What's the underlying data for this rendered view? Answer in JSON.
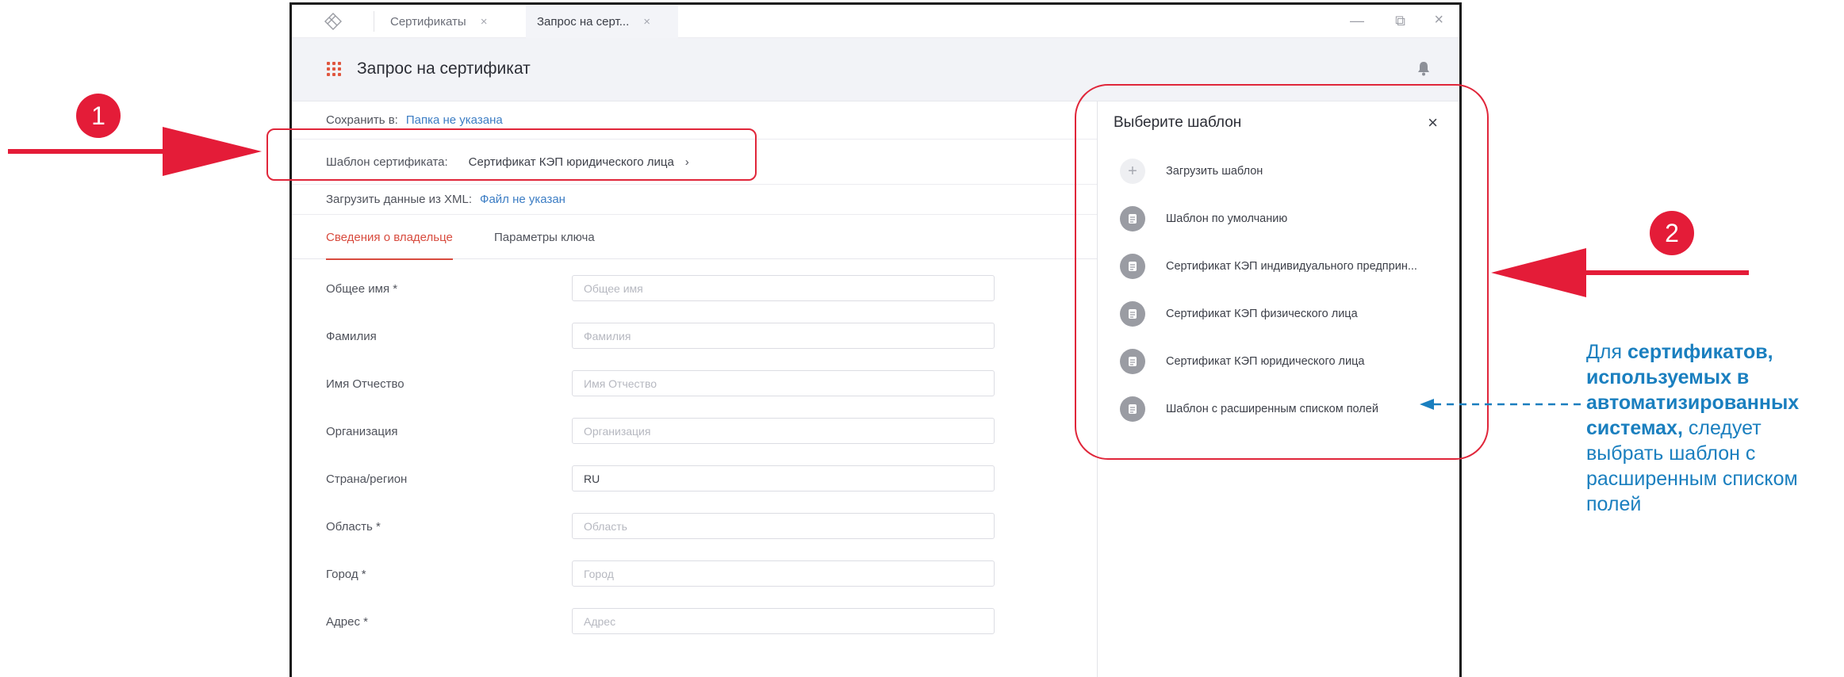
{
  "window": {
    "tabs": [
      {
        "label": "Сертификаты",
        "close": "×"
      },
      {
        "label": "Запрос на серт...",
        "close": "×"
      }
    ],
    "controls": {
      "minimize": "—",
      "restore": "⧉",
      "close": "×"
    }
  },
  "header": {
    "title": "Запрос на сертификат",
    "icons": [
      "apps-grid-icon",
      "bell-icon"
    ]
  },
  "form": {
    "save_label": "Сохранить в:",
    "save_value": "Папка не указана",
    "template_label": "Шаблон сертификата:",
    "template_value": "Сертификат КЭП юридического лица",
    "template_chevron": "›",
    "xml_label": "Загрузить данные из XML:",
    "xml_value": "Файл не указан",
    "tabs": [
      "Сведения о владельце",
      "Параметры ключа"
    ],
    "active_tab": "Сведения о владельце",
    "fields": [
      {
        "label": "Общее имя *",
        "placeholder": "Общее имя",
        "value": ""
      },
      {
        "label": "Фамилия",
        "placeholder": "Фамилия",
        "value": ""
      },
      {
        "label": "Имя Отчество",
        "placeholder": "Имя Отчество",
        "value": ""
      },
      {
        "label": "Организация",
        "placeholder": "Организация",
        "value": ""
      },
      {
        "label": "Страна/регион",
        "placeholder": "Страна/регион",
        "value": "RU"
      },
      {
        "label": "Область *",
        "placeholder": "Область",
        "value": ""
      },
      {
        "label": "Город *",
        "placeholder": "Город",
        "value": ""
      },
      {
        "label": "Адрес *",
        "placeholder": "Адрес",
        "value": ""
      }
    ]
  },
  "drawer": {
    "title": "Выберите шаблон",
    "close": "×",
    "upload_label": "Загрузить шаблон",
    "upload_icon": "+",
    "items": [
      "Шаблон по умолчанию",
      "Сертификат КЭП индивидуального предприн...",
      "Сертификат КЭП физического лица",
      "Сертификат КЭП юридического лица",
      "Шаблон с расширенным списком полей"
    ]
  },
  "annotations": {
    "badge_1": "1",
    "badge_2": "2",
    "note_parts": [
      "Для ",
      "сертификатов, используемых в автоматизированных системах,",
      " следует выбрать шаблон с расширенным списком полей"
    ],
    "colors": {
      "highlight": "#e0263a",
      "note": "#1a7fbf",
      "accent": "#d84b3e",
      "link": "#3c7dc4"
    }
  }
}
